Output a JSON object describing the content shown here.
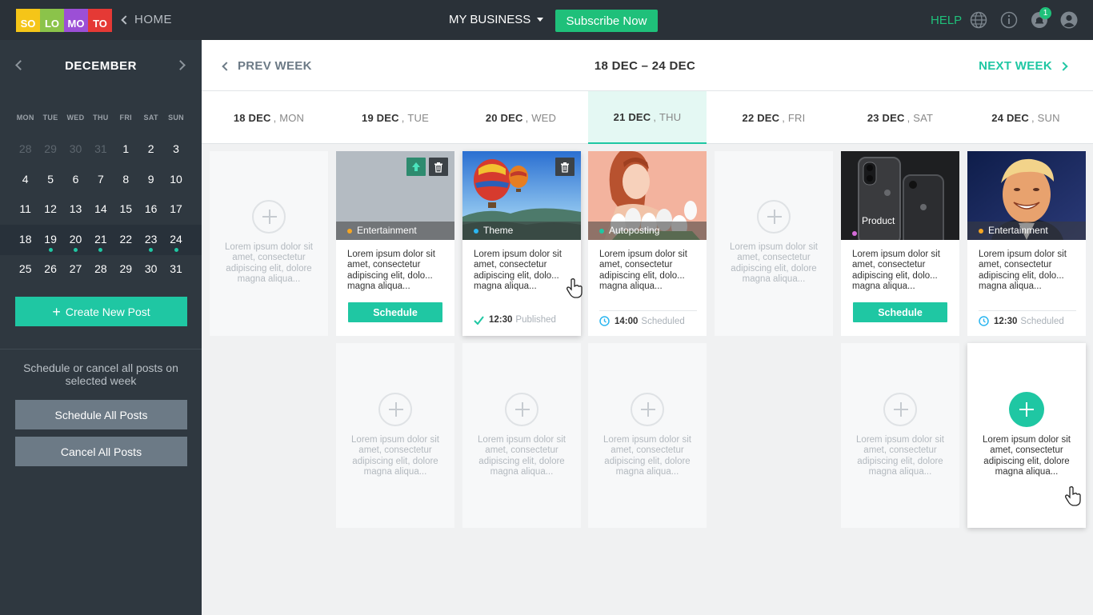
{
  "app": {
    "logo_letters": [
      "SO",
      "LO",
      "MO",
      "TO"
    ],
    "logo_colors": [
      "#f5c518",
      "#8bc34a",
      "#9c4fd6",
      "#e53935"
    ],
    "home_label": "HOME",
    "business_label": "MY BUSINESS",
    "subscribe_label": "Subscribe Now",
    "help_label": "HELP",
    "notification_count": "1",
    "accent_color": "#1fc7a3"
  },
  "sidebar": {
    "month": "DECEMBER",
    "weekdays": [
      "MON",
      "TUE",
      "WED",
      "THU",
      "FRI",
      "SAT",
      "SUN"
    ],
    "weeks": [
      [
        "28",
        "29",
        "30",
        "31",
        "1",
        "2",
        "3"
      ],
      [
        "4",
        "5",
        "6",
        "7",
        "8",
        "9",
        "10"
      ],
      [
        "11",
        "12",
        "13",
        "14",
        "15",
        "16",
        "17"
      ],
      [
        "18",
        "19",
        "20",
        "21",
        "22",
        "23",
        "24"
      ],
      [
        "25",
        "26",
        "27",
        "28",
        "29",
        "30",
        "31"
      ]
    ],
    "create_label": "Create New Post",
    "note": "Schedule or cancel all posts on selected week",
    "schedule_all_label": "Schedule All Posts",
    "cancel_all_label": "Cancel All Posts"
  },
  "week": {
    "prev_label": "PREV WEEK",
    "range": "18 DEC – 24 DEC",
    "next_label": "NEXT WEEK",
    "days": [
      {
        "date": "18 DEC",
        "day": "MON"
      },
      {
        "date": "19 DEC",
        "day": "TUE"
      },
      {
        "date": "20 DEC",
        "day": "WED"
      },
      {
        "date": "21 DEC",
        "day": "THU"
      },
      {
        "date": "22 DEC",
        "day": "FRI"
      },
      {
        "date": "23 DEC",
        "day": "SAT"
      },
      {
        "date": "24 DEC",
        "day": "SUN"
      }
    ]
  },
  "posts": {
    "placeholder_text": "Lorem ipsum dolor sit amet, consectetur adipiscing elit, dolore magna aliqua...",
    "post_text": "Lorem ipsum dolor sit amet, consectetur adipiscing elit, dolo... magna aliqua...",
    "schedule_label": "Schedule",
    "tue": {
      "tag": "Entertainment"
    },
    "wed": {
      "tag": "Theme",
      "time": "12:30",
      "status": "Published"
    },
    "thu": {
      "tag": "Autoposting",
      "time": "14:00",
      "status": "Scheduled"
    },
    "sat": {
      "tag": "Product"
    },
    "sun": {
      "tag": "Entertainment",
      "time": "12:30",
      "status": "Scheduled"
    }
  }
}
